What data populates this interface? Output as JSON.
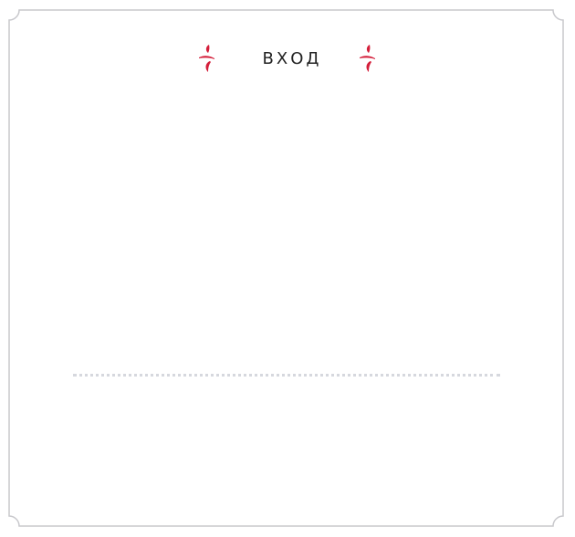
{
  "dialog": {
    "title": "ВХОД"
  },
  "icons": {
    "left_ornament": "red-flourish-icon",
    "right_ornament": "red-flourish-icon"
  },
  "colors": {
    "accent": "#d41e3a",
    "frame": "#c8c8cc",
    "divider": "#d6d8de",
    "title": "#222222"
  }
}
